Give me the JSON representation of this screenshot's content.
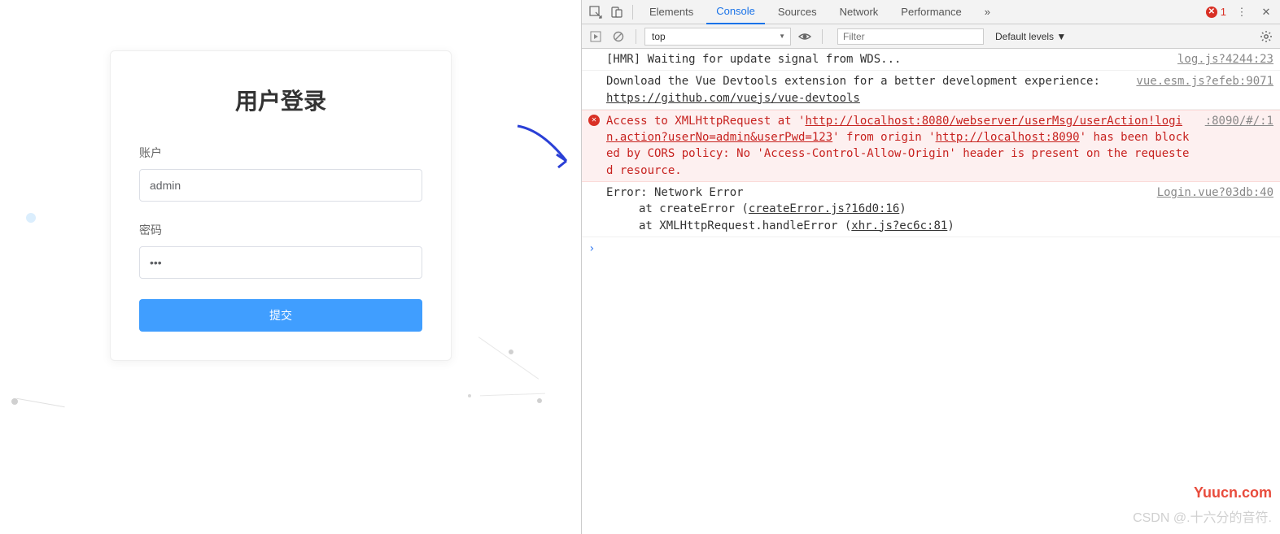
{
  "login": {
    "title": "用户登录",
    "account_label": "账户",
    "account_value": "admin",
    "password_label": "密码",
    "password_value": "•••",
    "submit_label": "提交"
  },
  "devtools": {
    "tabs": {
      "elements": "Elements",
      "console": "Console",
      "sources": "Sources",
      "network": "Network",
      "performance": "Performance",
      "more": "»"
    },
    "error_count": "1",
    "toolbar": {
      "context": "top",
      "filter_placeholder": "Filter",
      "levels": "Default levels ▼"
    },
    "messages": {
      "hmr_text": "[HMR] Waiting for update signal from WDS...",
      "hmr_src": "log.js?4244:23",
      "vue_devtools_text": "Download the Vue Devtools extension for a better development experience:",
      "vue_devtools_link": "https://github.com/vuejs/vue-devtools",
      "vue_devtools_src": "vue.esm.js?efeb:9071",
      "cors_pre": "Access to XMLHttpRequest at '",
      "cors_url": "http://localhost:8080/webserver/userMsg/userAction!login.action?userNo=admin&userPwd=123",
      "cors_mid": "' from origin '",
      "cors_origin": "http://localhost:8090",
      "cors_post": "' has been blocked by CORS policy: No 'Access-Control-Allow-Origin' header is present on the requested resource.",
      "cors_src": ":8090/#/:1",
      "net_error": "Error: Network Error",
      "net_line1_pre": "at createError (",
      "net_line1_link": "createError.js?16d0:16",
      "net_line1_post": ")",
      "net_line2_pre": "at XMLHttpRequest.handleError (",
      "net_line2_link": "xhr.js?ec6c:81",
      "net_line2_post": ")",
      "net_src": "Login.vue?03db:40"
    },
    "prompt": "›"
  },
  "watermark1": "Yuucn.com",
  "watermark2": "CSDN @.十六分的音符."
}
